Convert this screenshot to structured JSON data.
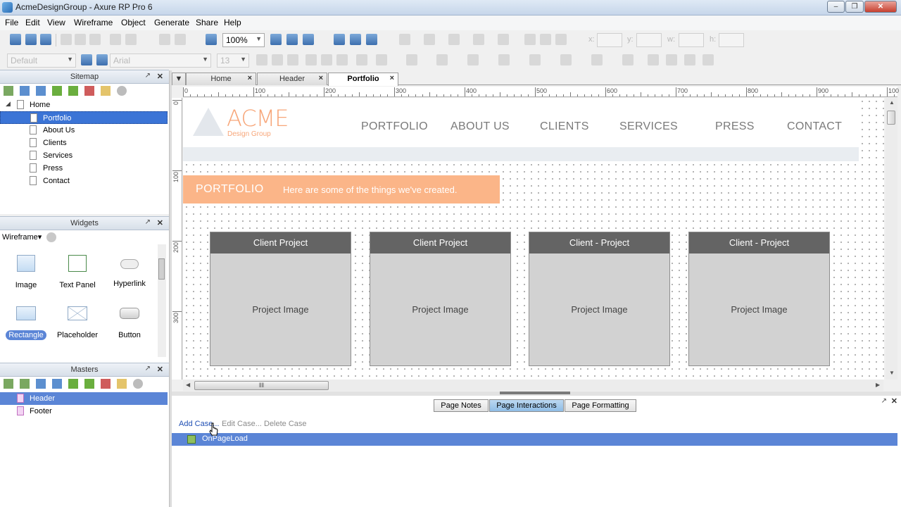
{
  "window": {
    "title": "AcmeDesignGroup - Axure RP Pro 6"
  },
  "menu": [
    "File",
    "Edit",
    "View",
    "Wireframe",
    "Object",
    "Generate",
    "Share",
    "Help"
  ],
  "toolbar": {
    "zoom": "100%",
    "style_combo": "Default",
    "font_combo": "Arial",
    "size_combo": "13",
    "x_label": "x:",
    "y_label": "y:",
    "w_label": "w:",
    "h_label": "h:"
  },
  "sitemap": {
    "title": "Sitemap",
    "items": [
      {
        "label": "Home"
      },
      {
        "label": "Portfolio"
      },
      {
        "label": "About Us"
      },
      {
        "label": "Clients"
      },
      {
        "label": "Services"
      },
      {
        "label": "Press"
      },
      {
        "label": "Contact"
      }
    ]
  },
  "widgets": {
    "title": "Widgets",
    "library": "Wireframe",
    "items": [
      {
        "label": "Image"
      },
      {
        "label": "Text Panel"
      },
      {
        "label": "Hyperlink"
      },
      {
        "label": "Rectangle"
      },
      {
        "label": "Placeholder"
      },
      {
        "label": "Button"
      }
    ]
  },
  "masters": {
    "title": "Masters",
    "items": [
      {
        "label": "Header"
      },
      {
        "label": "Footer"
      }
    ]
  },
  "tabs": [
    {
      "label": "Home"
    },
    {
      "label": "Header"
    },
    {
      "label": "Portfolio"
    }
  ],
  "ruler": {
    "h": [
      "0",
      "100",
      "200",
      "300",
      "400",
      "500",
      "600",
      "700",
      "800",
      "900",
      "100"
    ],
    "v": [
      "0",
      "100",
      "200",
      "300"
    ]
  },
  "page": {
    "logo": "ACME",
    "logo_sub": "Design Group",
    "nav": [
      "PORTFOLIO",
      "ABOUT US",
      "CLIENTS",
      "SERVICES",
      "PRESS",
      "CONTACT"
    ],
    "banner_title": "PORTFOLIO",
    "banner_text": "Here are some of the things we've created.",
    "cards": [
      {
        "title": "Client Project",
        "image": "Project Image"
      },
      {
        "title": "Client Project",
        "image": "Project Image"
      },
      {
        "title": "Client - Project",
        "image": "Project Image"
      },
      {
        "title": "Client - Project",
        "image": "Project Image"
      }
    ]
  },
  "bottom": {
    "tabs": [
      "Page Notes",
      "Page Interactions",
      "Page Formatting"
    ],
    "add_case": "Add Case...",
    "edit_case": "Edit Case...",
    "delete_case": "Delete Case",
    "event": "OnPageLoad"
  },
  "colors": {
    "accent_orange": "#fbb588",
    "logo_orange": "#f7a679",
    "selection_blue": "#3b74d6",
    "card_header": "#646464"
  }
}
